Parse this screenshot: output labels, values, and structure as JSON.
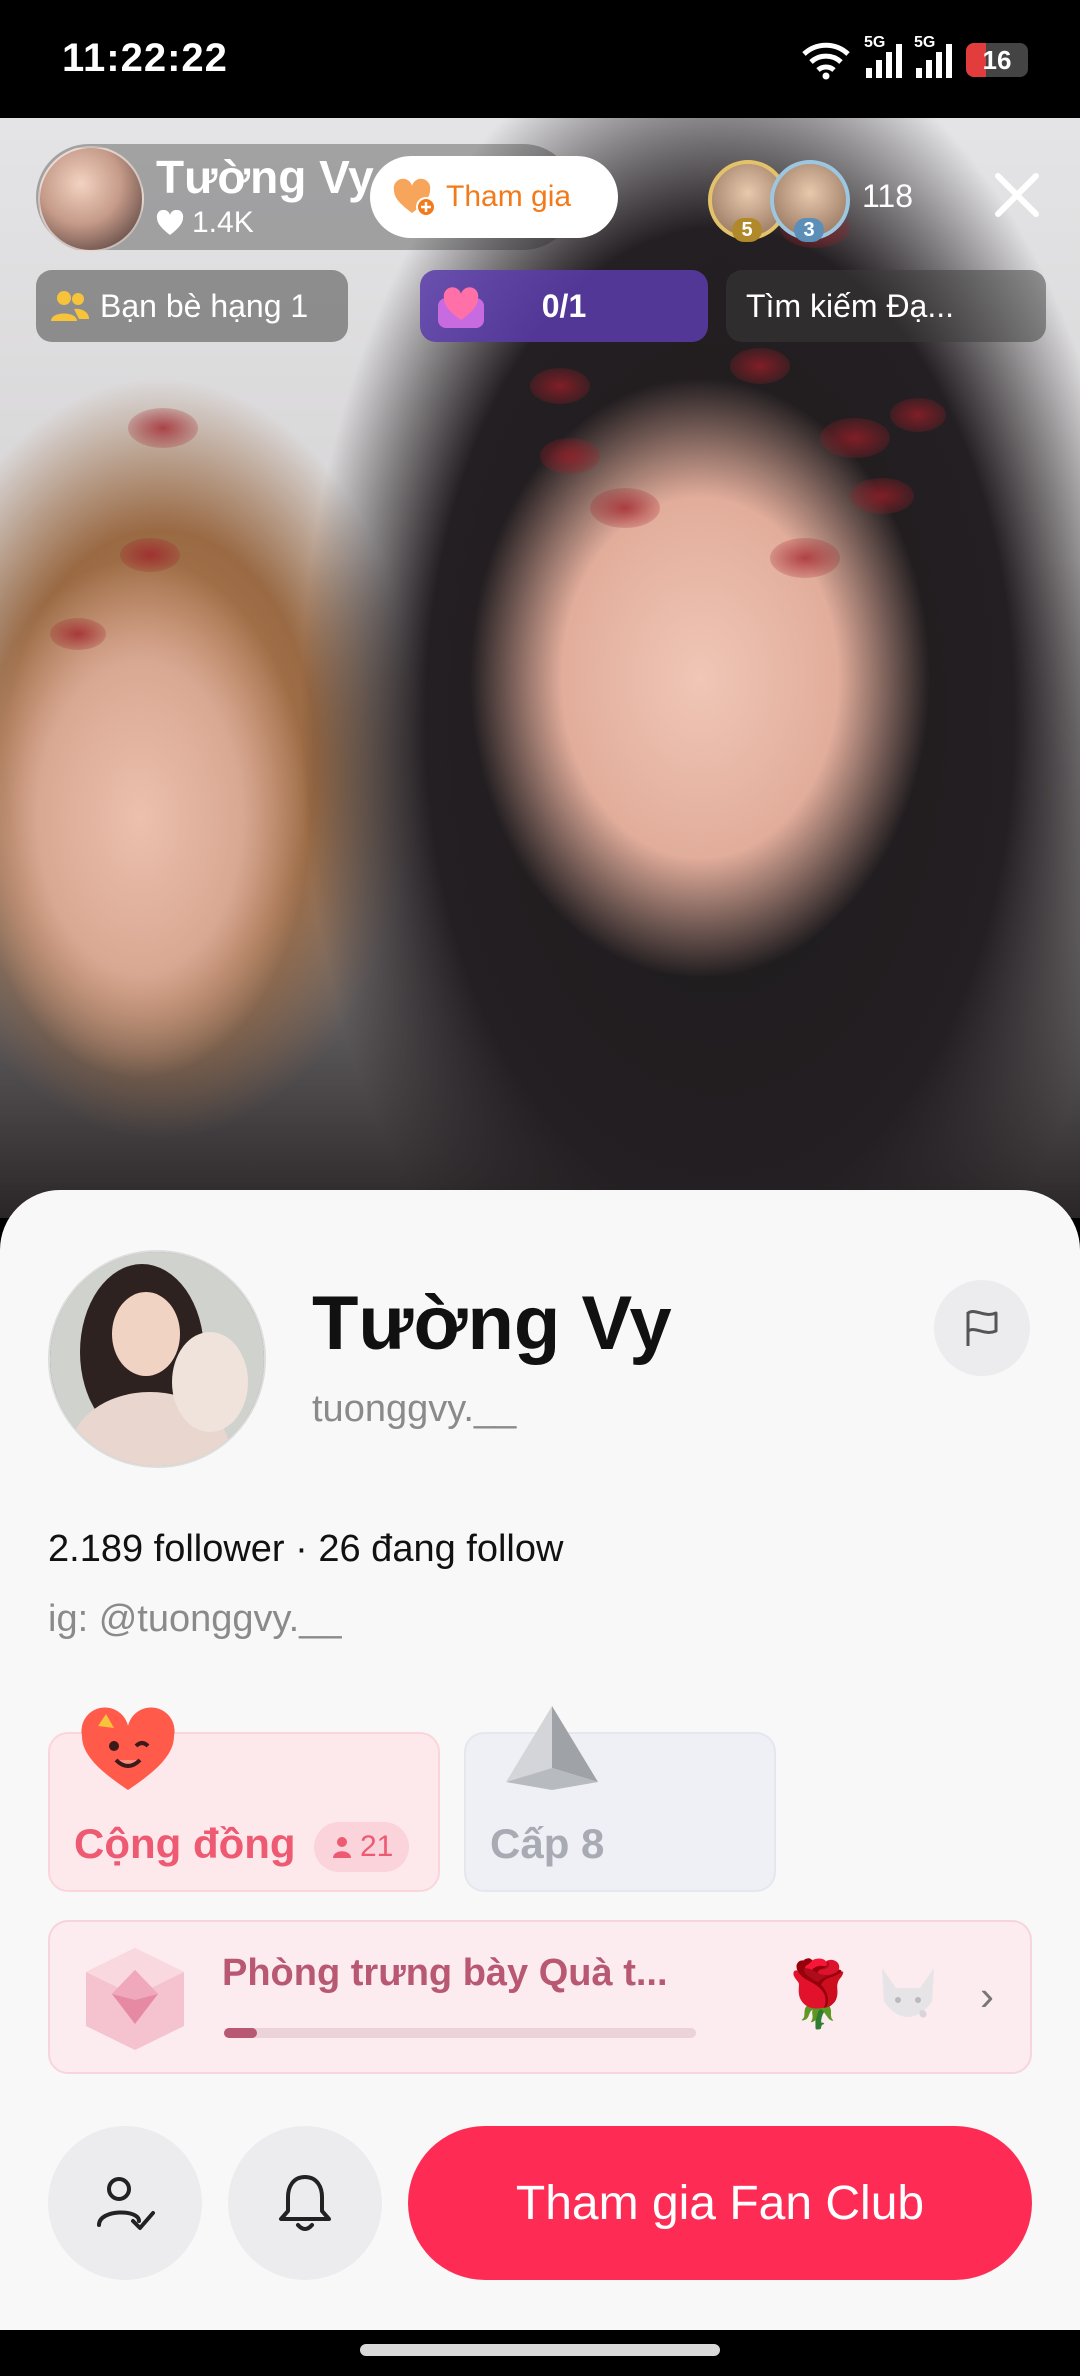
{
  "status_bar": {
    "time": "11:22:22",
    "battery": "16",
    "network_1": "5G",
    "network_2": "5G"
  },
  "live": {
    "host_name": "Tường Vy",
    "host_likes": "1.4K",
    "join_label": "Tham gia",
    "viewer_badges": [
      "5",
      "3"
    ],
    "viewer_count": "118",
    "chips": {
      "friends": "Bạn bè hạng 1",
      "progress": "0/1",
      "search": "Tìm kiếm Đạ..."
    }
  },
  "profile": {
    "name": "Tường Vy",
    "handle": "tuonggvy.__",
    "stats": "2.189 follower · 26 đang follow",
    "bio": "ig: @tuonggvy.__",
    "community_label": "Cộng đồng",
    "community_count": "21",
    "level_label": "Cấp 8",
    "gallery_title": "Phòng trưng bày Quà t...",
    "gallery_progress": 0.07,
    "fan_club_button": "Tham gia Fan Club"
  },
  "colors": {
    "primary": "#fe2c55",
    "join_text": "#f27a1a",
    "community": "#ee5a72",
    "gallery": "#b85872",
    "progress_chip": "#5a3caa"
  },
  "icons": [
    "wifi-icon",
    "signal-icon",
    "battery-icon",
    "heart-icon",
    "close-icon",
    "friends-icon",
    "flag-icon",
    "person-icon",
    "follow-check-icon",
    "bell-icon",
    "chevron-right-icon"
  ]
}
